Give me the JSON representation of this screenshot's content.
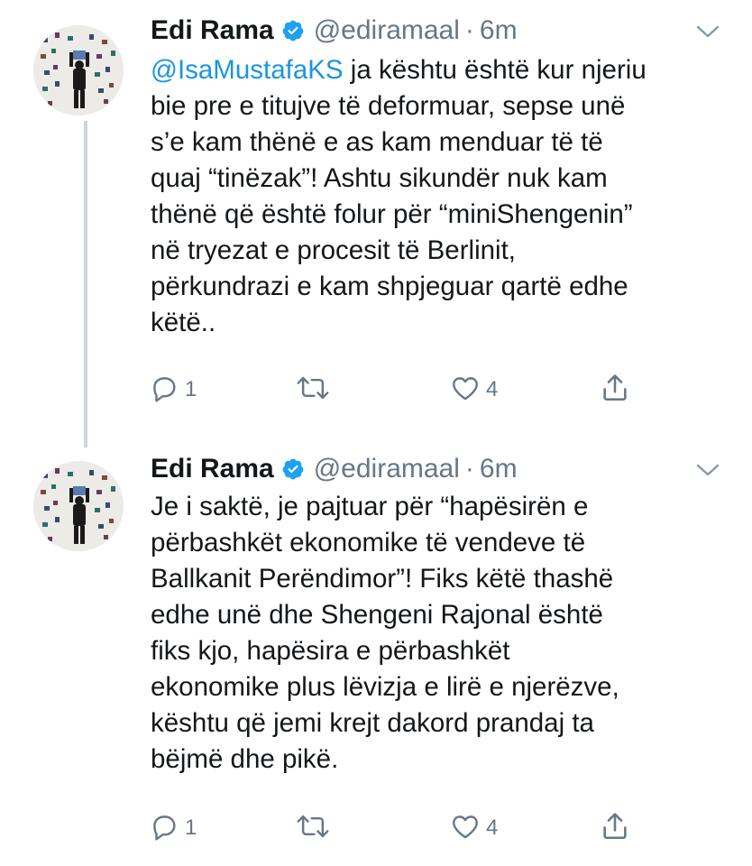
{
  "tweets": [
    {
      "author": {
        "name": "Edi Rama",
        "handle": "@ediramaal",
        "verified": true,
        "avatar_icon": "avatar-photo"
      },
      "separator": "·",
      "time": "6m",
      "mention": "@IsaMustafaKS",
      "lines": [
        " ja kështu është kur njeriu",
        "bie pre e titujve të deformuar, sepse unë",
        "s’e kam thënë e as kam menduar të të",
        "quaj “tinëzak”! Ashtu sikundër nuk kam",
        "thënë që është folur për “miniShengenin”",
        "në tryezat e procesit të Berlinit,",
        "përkundrazi e kam shpjeguar qartë edhe",
        "këtë.."
      ],
      "actions": {
        "reply_count": "1",
        "retweet_count": "",
        "like_count": "4"
      }
    },
    {
      "author": {
        "name": "Edi Rama",
        "handle": "@ediramaal",
        "verified": true,
        "avatar_icon": "avatar-photo"
      },
      "separator": "·",
      "time": "6m",
      "lines": [
        "Je i saktë, je pajtuar për “hapësirën e",
        "përbashkët ekonomike të vendeve të",
        "Ballkanit Perëndimor”! Fiks këtë thashë",
        "edhe unë dhe Shengeni Rajonal është",
        "fiks kjo, hapësira e përbashkët",
        "ekonomike plus lëvizja e lirë e njerëzve,",
        "kështu që jemi krejt dakord prandaj ta",
        "bëjmë dhe pikë."
      ],
      "actions": {
        "reply_count": "1",
        "retweet_count": "",
        "like_count": "4"
      }
    }
  ],
  "icons": {
    "verified": "verified-badge-icon",
    "caret": "chevron-down-icon",
    "reply": "reply-icon",
    "retweet": "retweet-icon",
    "like": "heart-icon",
    "share": "share-icon"
  },
  "colors": {
    "text": "#14171a",
    "secondary": "#657786",
    "link": "#1b95e0",
    "verified": "#1da1f2",
    "thread_line": "#ccd6dd"
  }
}
